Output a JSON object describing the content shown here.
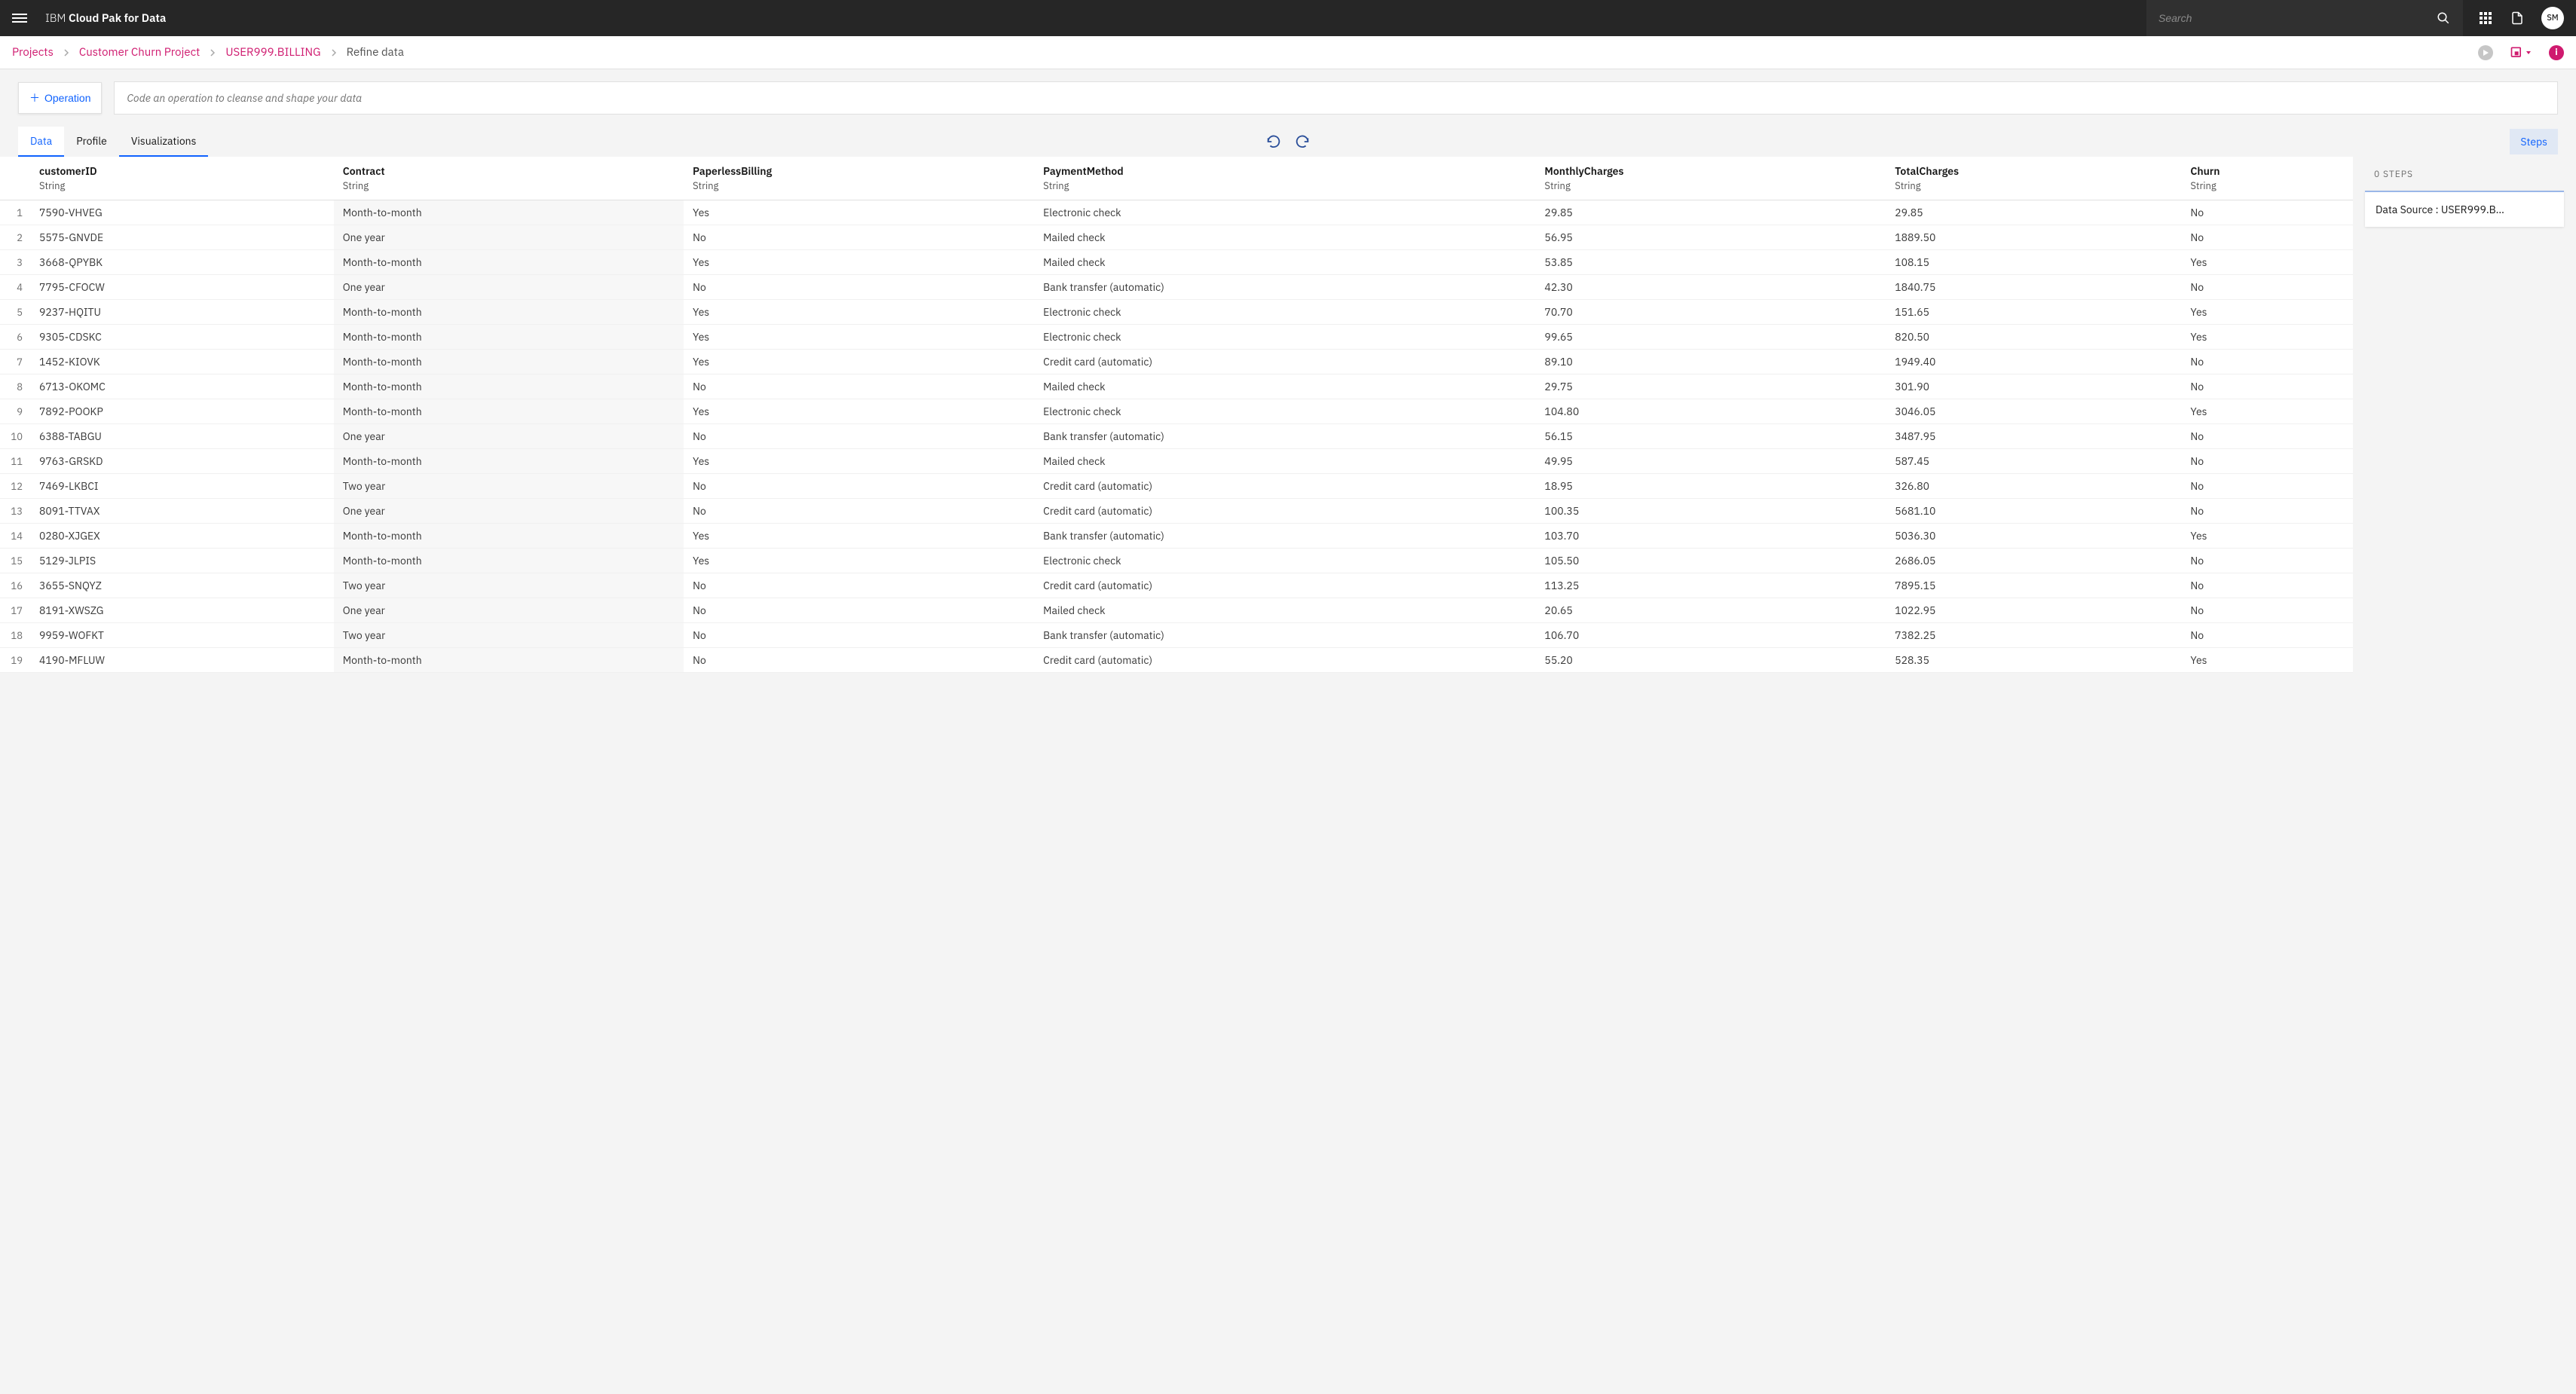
{
  "header": {
    "brand_light": "IBM ",
    "brand_bold": "Cloud Pak for Data",
    "search_placeholder": "Search",
    "avatar_initials": "SM"
  },
  "breadcrumb": {
    "items": [
      {
        "label": "Projects",
        "link": true
      },
      {
        "label": "Customer Churn Project",
        "link": true
      },
      {
        "label": "USER999.BILLING",
        "link": true
      },
      {
        "label": "Refine data",
        "link": false
      }
    ]
  },
  "ops": {
    "operation_button": "Operation",
    "code_hint": "Code an operation to cleanse and shape your data"
  },
  "tabs": {
    "items": [
      "Data",
      "Profile",
      "Visualizations"
    ],
    "active_index": 0,
    "steps_label": "Steps"
  },
  "table": {
    "columns": [
      {
        "name": "customerID",
        "type": "String",
        "shaded": false
      },
      {
        "name": "Contract",
        "type": "String",
        "shaded": true
      },
      {
        "name": "PaperlessBilling",
        "type": "String",
        "shaded": false
      },
      {
        "name": "PaymentMethod",
        "type": "String",
        "shaded": false
      },
      {
        "name": "MonthlyCharges",
        "type": "String",
        "shaded": false
      },
      {
        "name": "TotalCharges",
        "type": "String",
        "shaded": false
      },
      {
        "name": "Churn",
        "type": "String",
        "shaded": false
      }
    ],
    "rows": [
      [
        "7590-VHVEG",
        "Month-to-month",
        "Yes",
        "Electronic check",
        "29.85",
        "29.85",
        "No"
      ],
      [
        "5575-GNVDE",
        "One year",
        "No",
        "Mailed check",
        "56.95",
        "1889.50",
        "No"
      ],
      [
        "3668-QPYBK",
        "Month-to-month",
        "Yes",
        "Mailed check",
        "53.85",
        "108.15",
        "Yes"
      ],
      [
        "7795-CFOCW",
        "One year",
        "No",
        "Bank transfer (automatic)",
        "42.30",
        "1840.75",
        "No"
      ],
      [
        "9237-HQITU",
        "Month-to-month",
        "Yes",
        "Electronic check",
        "70.70",
        "151.65",
        "Yes"
      ],
      [
        "9305-CDSKC",
        "Month-to-month",
        "Yes",
        "Electronic check",
        "99.65",
        "820.50",
        "Yes"
      ],
      [
        "1452-KIOVK",
        "Month-to-month",
        "Yes",
        "Credit card (automatic)",
        "89.10",
        "1949.40",
        "No"
      ],
      [
        "6713-OKOMC",
        "Month-to-month",
        "No",
        "Mailed check",
        "29.75",
        "301.90",
        "No"
      ],
      [
        "7892-POOKP",
        "Month-to-month",
        "Yes",
        "Electronic check",
        "104.80",
        "3046.05",
        "Yes"
      ],
      [
        "6388-TABGU",
        "One year",
        "No",
        "Bank transfer (automatic)",
        "56.15",
        "3487.95",
        "No"
      ],
      [
        "9763-GRSKD",
        "Month-to-month",
        "Yes",
        "Mailed check",
        "49.95",
        "587.45",
        "No"
      ],
      [
        "7469-LKBCI",
        "Two year",
        "No",
        "Credit card (automatic)",
        "18.95",
        "326.80",
        "No"
      ],
      [
        "8091-TTVAX",
        "One year",
        "No",
        "Credit card (automatic)",
        "100.35",
        "5681.10",
        "No"
      ],
      [
        "0280-XJGEX",
        "Month-to-month",
        "Yes",
        "Bank transfer (automatic)",
        "103.70",
        "5036.30",
        "Yes"
      ],
      [
        "5129-JLPIS",
        "Month-to-month",
        "Yes",
        "Electronic check",
        "105.50",
        "2686.05",
        "No"
      ],
      [
        "3655-SNQYZ",
        "Two year",
        "No",
        "Credit card (automatic)",
        "113.25",
        "7895.15",
        "No"
      ],
      [
        "8191-XWSZG",
        "One year",
        "No",
        "Mailed check",
        "20.65",
        "1022.95",
        "No"
      ],
      [
        "9959-WOFKT",
        "Two year",
        "No",
        "Bank transfer (automatic)",
        "106.70",
        "7382.25",
        "No"
      ],
      [
        "4190-MFLUW",
        "Month-to-month",
        "No",
        "Credit card (automatic)",
        "55.20",
        "528.35",
        "Yes"
      ]
    ]
  },
  "steps_panel": {
    "count_label": "0 STEPS",
    "data_source_label": "Data Source : USER999.B…"
  }
}
